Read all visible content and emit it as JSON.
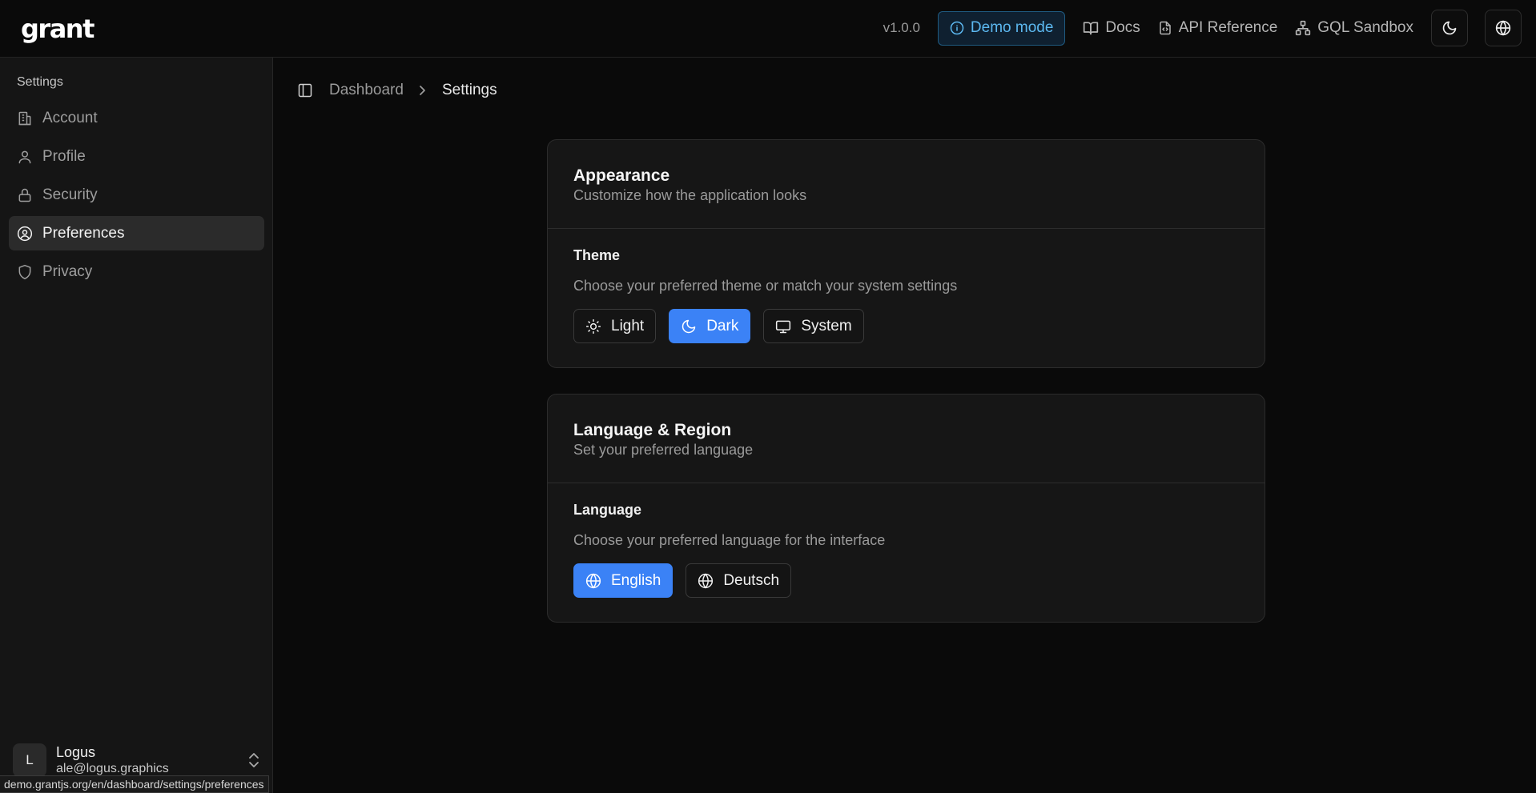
{
  "app": {
    "logo": "grant"
  },
  "topbar": {
    "version": "v1.0.0",
    "demo_badge": "Demo mode",
    "links": [
      "Docs",
      "API Reference",
      "GQL Sandbox"
    ],
    "theme_toggle_icon": "moon-icon",
    "language_icon": "globe-icon"
  },
  "sidebar": {
    "heading": "Settings",
    "items": [
      {
        "label": "Account",
        "icon": "building-icon"
      },
      {
        "label": "Profile",
        "icon": "user-icon"
      },
      {
        "label": "Security",
        "icon": "lock-icon"
      },
      {
        "label": "Preferences",
        "icon": "user-circle-icon",
        "active": true
      },
      {
        "label": "Privacy",
        "icon": "shield-icon"
      }
    ],
    "user": {
      "initial": "L",
      "name": "Logus",
      "email": "ale@logus.graphics"
    }
  },
  "breadcrumb": {
    "items": [
      "Dashboard",
      "Settings"
    ]
  },
  "appearance": {
    "title": "Appearance",
    "subtitle": "Customize how the application looks",
    "theme": {
      "label": "Theme",
      "description": "Choose your preferred theme or match your system settings",
      "options": [
        "Light",
        "Dark",
        "System"
      ],
      "selected": "Dark"
    }
  },
  "language_region": {
    "title": "Language & Region",
    "subtitle": "Set your preferred language",
    "language": {
      "label": "Language",
      "description": "Choose your preferred language for the interface",
      "options": [
        "English",
        "Deutsch"
      ],
      "selected": "English"
    }
  },
  "status_bar": {
    "url": "demo.grantjs.org/en/dashboard/settings/preferences"
  },
  "colors": {
    "accent": "#3b82f6",
    "demo_badge": "#5cb8f0",
    "background": "#0a0a0a",
    "sidebar": "#151515"
  }
}
